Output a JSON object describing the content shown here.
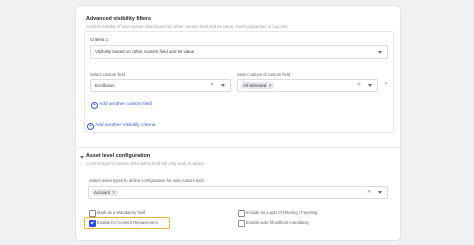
{
  "visibility": {
    "title": "Advanced visibility filters",
    "subtitle": "Control visibility of new custom field based on other custom field and its value, Asset properties or Layouts.",
    "criteria_title": "Criteria 1",
    "criteria_select_value": "Visibility based on other custom field and its value",
    "custom_field_label": "Select custom field",
    "custom_field_value": "Evolfotion",
    "values_label": "Select values of custom field",
    "values_chip": "All Selected",
    "add_custom_field": "Add another custom field",
    "add_visibility": "Add another Visibility criteria"
  },
  "asset_level": {
    "title": "Asset level configuration",
    "subtitle": "Control level of custom field within field will only work in Space",
    "asset_types_label": "Select asset types to define configuration for new custom field",
    "asset_chip": "Account",
    "checkboxes": [
      {
        "label": "Mark as a Mandatory field",
        "checked": false
      },
      {
        "label": "Include as a part of Filtering / Faceting",
        "checked": false
      },
      {
        "label": "Enable for Content Replacement",
        "checked": true
      },
      {
        "label": "Enable auto-fill without mandatory",
        "checked": false
      }
    ]
  },
  "colors": {
    "accent": "#2d4fe0",
    "highlight": "#f2b531"
  }
}
